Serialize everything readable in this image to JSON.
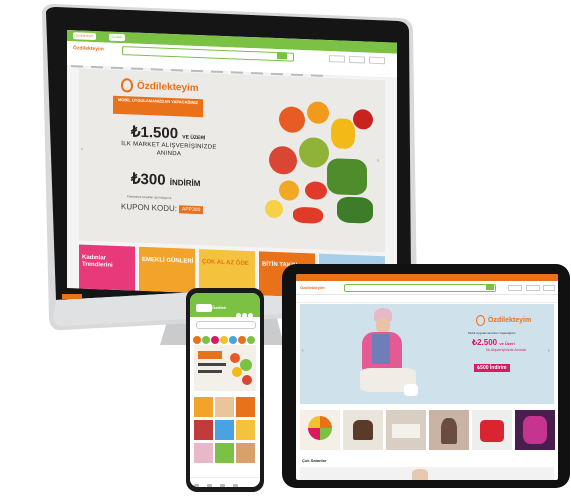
{
  "monitor": {
    "topbar": {
      "pill_1": "Özdilekteyim",
      "pill_2": "Özdilek"
    },
    "logo": "Özdilekteyim",
    "hero": {
      "brand": "Özdilekteyim",
      "ribbon": "MOBİL UYGULAMANIZDAN YAPACAĞINIZ",
      "amount": "₺1.500",
      "amount_suffix": "VE ÜZERİ",
      "line": "İLK MARKET ALIŞVERİŞİNİZDE ANINDA",
      "discount": "₺300",
      "discount_suffix": "İNDİRİM",
      "fine_print": "Kampanya koşulları için tıklayınız.",
      "coupon_label": "KUPON KODU:",
      "coupon_code": "APP300"
    },
    "tiles": [
      {
        "text": "Kadınlar Trendlerini"
      },
      {
        "text": "EMEKLİ GÜNLERİ"
      },
      {
        "text": "ÇOK AL AZ ÖDE"
      },
      {
        "text": "BİTİN TAKIN"
      }
    ]
  },
  "tablet": {
    "logo": "Özdilekteyim",
    "hero": {
      "brand": "Özdilekteyim",
      "sub": "Mobil Uygulamanızdan Yapacağınız",
      "amount": "₺2.500",
      "amount_suffix": "ve Üzeri",
      "line": "İlk Alışverişinizde Anında",
      "discount": "₺500 İndirim"
    },
    "section_title": "Çok Satanlar"
  },
  "phone": {
    "logo": "Özdilek"
  },
  "colors": {
    "brand_orange": "#e8711a",
    "brand_green": "#7bc143",
    "accent_pink": "#d81b60"
  }
}
